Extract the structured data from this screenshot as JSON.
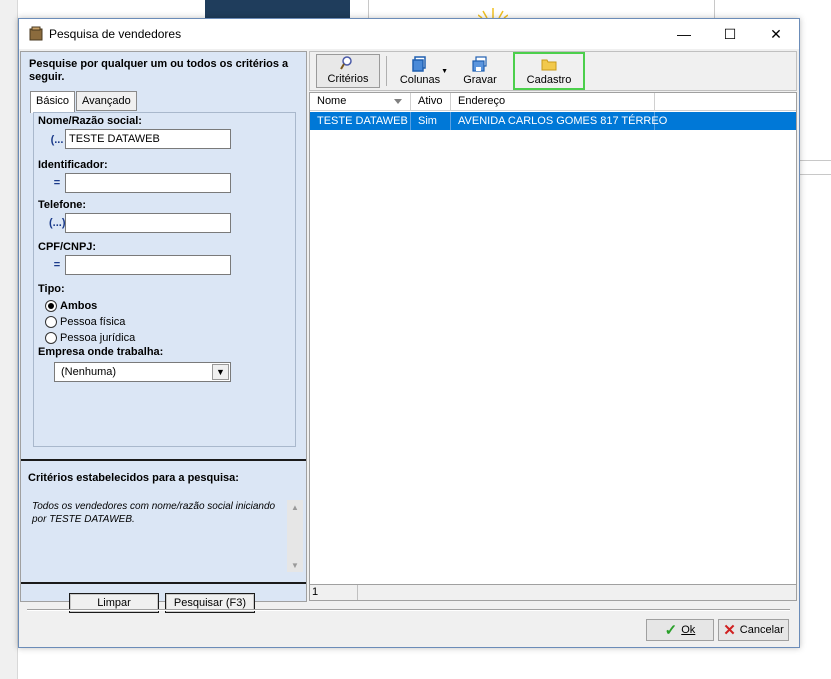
{
  "window": {
    "title": "Pesquisa de vendedores",
    "min_symbol": "—",
    "max_symbol": "☐",
    "close_symbol": "✕"
  },
  "left": {
    "heading": "Pesquise por qualquer um ou todos os critérios a seguir.",
    "tabs": [
      {
        "label": "Básico",
        "active": true
      },
      {
        "label": "Avançado",
        "active": false
      }
    ],
    "fields": [
      {
        "label": "Nome/Razão social:",
        "prefix": "(...",
        "value": ""
      },
      {
        "label": "Identificador:",
        "prefix": "=",
        "value": ""
      },
      {
        "label": "Telefone:",
        "prefix": "(...)",
        "value": ""
      },
      {
        "label": "CPF/CNPJ:",
        "prefix": "=",
        "value": ""
      }
    ],
    "name_value": "TESTE DATAWEB",
    "tipo_label": "Tipo:",
    "tipo_options": [
      {
        "label": "Ambos",
        "checked": true
      },
      {
        "label": "Pessoa física",
        "checked": false
      },
      {
        "label": "Pessoa jurídica",
        "checked": false
      }
    ],
    "empresa_label": "Empresa onde trabalha:",
    "empresa_value": "(Nenhuma)",
    "criterios_heading": "Critérios estabelecidos para a pesquisa:",
    "criterios_text": "Todos os vendedores com nome/razão social iniciando por TESTE DATAWEB.",
    "btn_limpar": "Limpar",
    "btn_pesquisar": "Pesquisar (F3)"
  },
  "toolbar": {
    "criterios": "Critérios",
    "colunas": "Colunas",
    "gravar": "Gravar",
    "cadastro": "Cadastro",
    "highlight_color": "#4ccf4c"
  },
  "grid": {
    "columns": [
      "Nome",
      "Ativo",
      "Endereço"
    ],
    "rows": [
      {
        "nome": "TESTE DATAWEB",
        "ativo": "Sim",
        "endereco": "AVENIDA CARLOS GOMES 817 TÉRREO"
      }
    ],
    "selected_color": "#0078d7",
    "count": "1"
  },
  "dialog": {
    "ok_label": "Ok",
    "cancel_label": "Cancelar"
  }
}
